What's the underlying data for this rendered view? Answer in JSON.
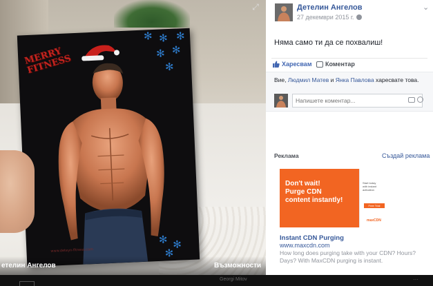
{
  "photo": {
    "card_title_line1": "MERRY",
    "card_title_line2": "FITNESS",
    "card_url": "www.deteyn-fitness.com",
    "owner_name": "етелин Ангелов",
    "options_label": "Възможности",
    "strip_name": "Georgi Mitov"
  },
  "post": {
    "author": "Детелин Ангелов",
    "date": "27 декември 2015 г.",
    "text": "Няма само ти да се похвалиш!",
    "like_label": "Харесвам",
    "comment_label": "Коментар",
    "likes_prefix": "Вие, ",
    "liker_1": "Людмил Матев",
    "likes_and": " и ",
    "liker_2": "Янка Павлова",
    "likes_suffix": " харесвате това.",
    "comment_placeholder": "Напишете коментар..."
  },
  "ad": {
    "header": "Реклама",
    "create_label": "Създай реклама",
    "headline_1": "Don't wait!",
    "headline_2": "Purge CDN",
    "headline_3": "content instantly!",
    "side_line_1": "Start today",
    "side_line_2": "with instant",
    "side_line_3": "activation",
    "trial_label": "Free Trial",
    "logo": "maxCDN",
    "title": "Instant CDN Purging",
    "domain": "www.maxcdn.com",
    "description": "How long does purging take with your CDN? Hours? Days? With MaxCDN purging is instant."
  },
  "icons": {
    "expand": "expand-icon",
    "chevron": "chevron-down-icon",
    "like": "thumbs-up-icon",
    "comment": "comment-bubble-icon",
    "camera": "camera-icon",
    "emoji": "emoji-icon",
    "globe": "globe-icon"
  },
  "colors": {
    "link": "#365899",
    "accent": "#4267b2",
    "ad_orange": "#f26522"
  }
}
